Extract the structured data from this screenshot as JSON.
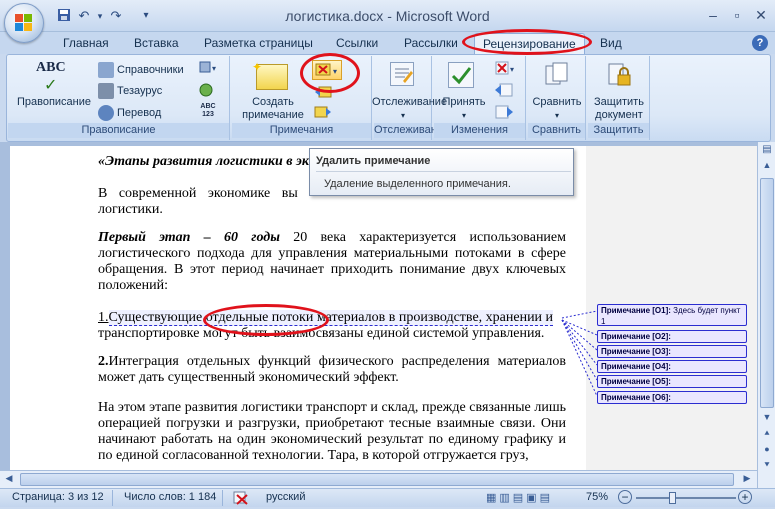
{
  "window": {
    "title": "логистика.docx - Microsoft Word"
  },
  "quick_access": [
    "save-icon",
    "undo-icon",
    "redo-icon",
    "customize-icon"
  ],
  "tabs": [
    {
      "label": "Главная"
    },
    {
      "label": "Вставка"
    },
    {
      "label": "Разметка страницы"
    },
    {
      "label": "Ссылки"
    },
    {
      "label": "Рассылки"
    },
    {
      "label": "Рецензирование",
      "active": true
    },
    {
      "label": "Вид"
    }
  ],
  "ribbon": {
    "proofing": {
      "label": "Правописание",
      "spelling": "Правописание",
      "research": "Справочники",
      "thesaurus": "Тезаурус",
      "translate": "Перевод"
    },
    "comments": {
      "label": "Примечания",
      "new_comment_line1": "Создать",
      "new_comment_line2": "примечание"
    },
    "tracking": {
      "label": "Отслеживание",
      "button": "Отслеживание"
    },
    "changes": {
      "label": "Изменения",
      "accept": "Принять"
    },
    "compare": {
      "label": "Сравнить",
      "button": "Сравнить"
    },
    "protect": {
      "label": "Защитить",
      "button_line1": "Защитить",
      "button_line2": "документ"
    }
  },
  "tooltip": {
    "title": "Удалить примечание",
    "description": "Удаление выделенного примечания."
  },
  "document": {
    "heading": "«Этапы развития логистики в эк",
    "p1_visible_a": "В современной экономике вы",
    "p1_visible_b": "логистики.",
    "p2_bold": "Первый этап – 60 годы",
    "p2_rest": " 20 века характеризуется использованием логистического подхода для управления материальными потоками в сфере обращения. В этот период начинает приходить понимание двух ключевых положений:",
    "p3_num": "1.",
    "p3_line1": "Существующие отдельные потоки материалов в производстве, хранении и",
    "p3_line2": "транспортировке могут быть взаимосвязаны единой системой управления.",
    "p4_num": "2.",
    "p4_text": "Интеграция отдельных функций физического распределения материалов может дать существенный экономический эффект.",
    "p5_text": "На этом этапе развития логистики транспорт и склад, прежде связанные лишь операцией погрузки и разгрузки, приобретают тесные взаимные связи. Они начинают работать на один экономический результат по единому графику и по единой согласованной технологии. Тара, в которой отгружается груз,"
  },
  "comments": [
    {
      "label": "Примечание [О1]:",
      "text": "Здесь будет пункт 1"
    },
    {
      "label": "Примечание [О2]:"
    },
    {
      "label": "Примечание [О3]:"
    },
    {
      "label": "Примечание [О4]:"
    },
    {
      "label": "Примечание [О5]:"
    },
    {
      "label": "Примечание [О6]:"
    }
  ],
  "status": {
    "page": "Страница: 3 из 12",
    "words": "Число слов: 1 184",
    "language": "русский",
    "zoom": "75%"
  },
  "colors": {
    "annotation_red": "#e0121b",
    "comment_border": "#2b2dd0"
  }
}
